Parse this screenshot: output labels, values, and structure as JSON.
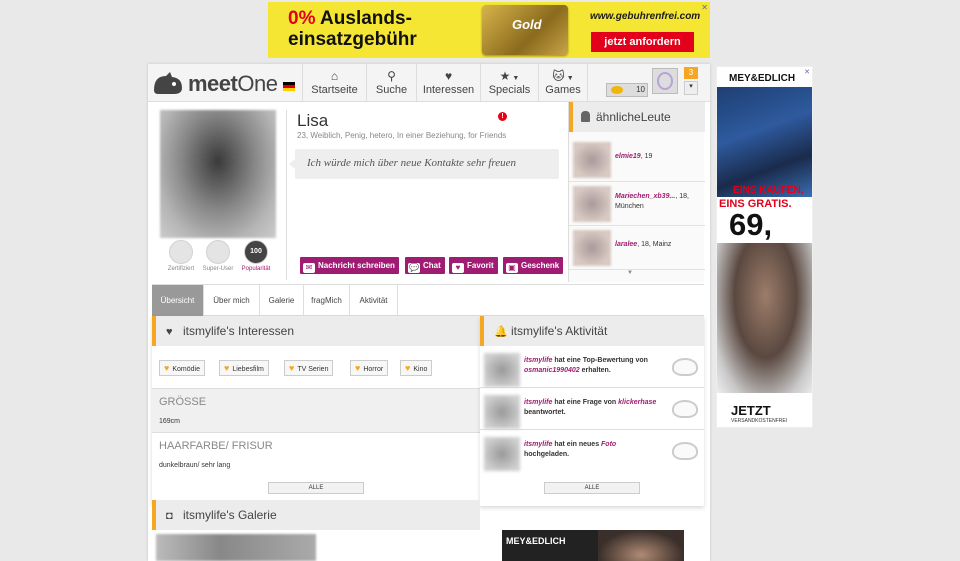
{
  "top_ad": {
    "pct": "0%",
    "line1": "Auslands-",
    "line2": "einsatzgebühr",
    "card_label": "Gold",
    "url": "www.gebuhrenfrei.com",
    "cta": "jetzt anfordern",
    "close": "✕"
  },
  "nav": {
    "logo_prefix": "meet",
    "logo_suffix": "One",
    "items": [
      {
        "label": "Startseite",
        "icon": "home-icon"
      },
      {
        "label": "Suche",
        "icon": "pin-icon"
      },
      {
        "label": "Interessen",
        "icon": "heart-icon"
      },
      {
        "label": "Specials",
        "icon": "star-icon"
      },
      {
        "label": "Games",
        "icon": "cat-icon"
      }
    ],
    "coins": "10",
    "notifications": "3"
  },
  "profile": {
    "name": "Lisa",
    "meta": "23, Weiblich, Penig, hetero, In einer Beziehung, for Friends",
    "quote": "Ich würde mich über neue Kontakte sehr freuen",
    "badges": [
      {
        "label": "Zertifiziert"
      },
      {
        "label": "Super-User"
      },
      {
        "label": "Popularität",
        "value": "100"
      }
    ],
    "actions": [
      "Nachricht schreiben",
      "Chat",
      "Favorit",
      "Geschenk"
    ]
  },
  "similar": {
    "title": "ähnlicheLeute",
    "people": [
      {
        "user": "elmie19",
        "info": ", 19",
        "info2": ""
      },
      {
        "user": "Mariechen_xb39...",
        "info": ", 18,",
        "info2": "München"
      },
      {
        "user": "laralee",
        "info": ", 18, Mainz",
        "info2": ""
      }
    ]
  },
  "tabs": [
    "Übersicht",
    "Über mich",
    "Galerie",
    "fragMich",
    "Aktivität"
  ],
  "interests": {
    "title": "itsmylife's Interessen",
    "tags": [
      "Komödie",
      "Liebesfilm",
      "TV Serien",
      "Horror",
      "Kino"
    ],
    "fields": [
      {
        "label": "GRÖSSE",
        "value": "169cm"
      },
      {
        "label": "HAARFARBE/ FRISUR",
        "value": "dunkelbraun/ sehr lang"
      }
    ],
    "all_button": "ALLE"
  },
  "activity": {
    "title": "itsmylife's Aktivität",
    "items": [
      {
        "user": "itsmylife",
        "text": " hat eine Top-Bewertung von ",
        "link": "osmanic1990402",
        "tail": " erhalten."
      },
      {
        "user": "itsmylife",
        "text": " hat eine Frage von ",
        "link": "klickerhase",
        "tail": " beantwortet."
      },
      {
        "user": "itsmylife",
        "text": " hat ein neues ",
        "link": "Foto",
        "tail": " hochgeladen."
      }
    ],
    "all_button": "ALLE"
  },
  "gallery": {
    "title": "itsmylife's Galerie"
  },
  "bottom_ad": {
    "brand": "MEY&EDLICH"
  },
  "side_ad": {
    "brand": "MEY&EDLICH",
    "line1": "EINS KAUFEN,",
    "line2": "EINS GRATIS.",
    "price": "69,",
    "cta": "JETZT",
    "sub": "VERSANDKOSTENFREI",
    "close": "✕"
  }
}
